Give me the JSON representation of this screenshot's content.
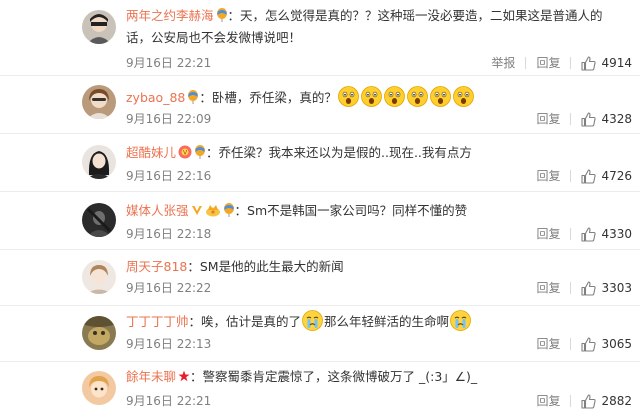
{
  "colors": {
    "username": "#eb7350",
    "meta": "#808080",
    "divider": "#ececec"
  },
  "action_labels": {
    "report": "举报",
    "reply": "回复"
  },
  "comments": [
    {
      "username": "两年之约李赫海",
      "badges": [
        "balloon-badge-icon"
      ],
      "text_lines": [
        "：天，怎么觉得是真的？？这种瑶一没必要造，二如果这是普通人的",
        "话，公安局也不会发微博说吧！"
      ],
      "timestamp": "9月16日 22:21",
      "show_report": true,
      "likes": "4914"
    },
    {
      "username": "zybao_88",
      "badges": [
        "balloon-badge-icon"
      ],
      "text": "：卧槽，乔任梁，真的？",
      "trailing_emoji_count": 6,
      "emoji_name": "shocked-face-emoji-icon",
      "timestamp": "9月16日 22:09",
      "likes": "4328"
    },
    {
      "username": "超酷妹儿",
      "badges": [
        "vip-badge-icon",
        "balloon-badge-icon"
      ],
      "text": "：乔任梁？我本来还以为是假的..现在..我有点方",
      "timestamp": "9月16日 22:16",
      "likes": "4726"
    },
    {
      "username": "媒体人张强",
      "badges": [
        "verified-v-badge-icon",
        "crown-badge-icon",
        "balloon-badge-icon"
      ],
      "text": "：Sm不是韩国一家公司吗？同样不懂的赞",
      "timestamp": "9月16日 22:18",
      "likes": "4330"
    },
    {
      "username": "周天子818",
      "badges": [],
      "text": "：SM是他的此生最大的新闻",
      "timestamp": "9月16日 22:22",
      "likes": "3303"
    },
    {
      "username": "丁丁丁丁帅",
      "badges": [],
      "text_parts": [
        "：唉，估计是真的了",
        "那么年轻鲜活的生命啊"
      ],
      "emoji_name": "crying-face-emoji-icon",
      "timestamp": "9月16日 22:13",
      "likes": "3065"
    },
    {
      "username": "餘年未聊",
      "badges": [
        "star-badge-icon"
      ],
      "text": "：警察蜀黍肯定震惊了，这条微博破万了 _(:3」∠)_",
      "timestamp": "9月16日 22:21",
      "likes": "2882"
    }
  ]
}
